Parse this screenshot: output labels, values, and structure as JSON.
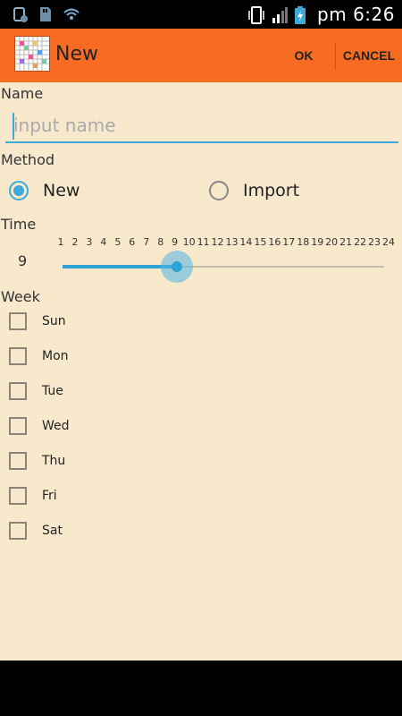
{
  "status_bar": {
    "clock": "pm 6:26",
    "left_icons": [
      "usb-debug-icon",
      "sd-card-icon",
      "wifi-icon"
    ],
    "right_icons": [
      "vibrate-icon",
      "signal-icon",
      "battery-charging-icon"
    ]
  },
  "action_bar": {
    "title": "New",
    "ok_label": "OK",
    "cancel_label": "CANCEL",
    "background": "#f76b22"
  },
  "form": {
    "name_label": "Name",
    "name_placeholder": "input name",
    "name_value": "",
    "method_label": "Method",
    "method_options": [
      {
        "label": "New",
        "checked": true
      },
      {
        "label": "Import",
        "checked": false
      }
    ],
    "time_label": "Time",
    "time_value": "9",
    "time_ticks": [
      "1",
      "2",
      "3",
      "4",
      "5",
      "6",
      "7",
      "8",
      "9",
      "10",
      "11",
      "12",
      "13",
      "14",
      "15",
      "16",
      "17",
      "18",
      "19",
      "20",
      "21",
      "22",
      "23",
      "24"
    ],
    "week_label": "Week",
    "days": [
      {
        "label": "Sun",
        "checked": false
      },
      {
        "label": "Mon",
        "checked": false
      },
      {
        "label": "Tue",
        "checked": false
      },
      {
        "label": "Wed",
        "checked": false
      },
      {
        "label": "Thu",
        "checked": false
      },
      {
        "label": "Fri",
        "checked": false
      },
      {
        "label": "Sat",
        "checked": false
      }
    ]
  },
  "colors": {
    "accent": "#2fa3d6",
    "content_background": "#f8e8cc"
  }
}
